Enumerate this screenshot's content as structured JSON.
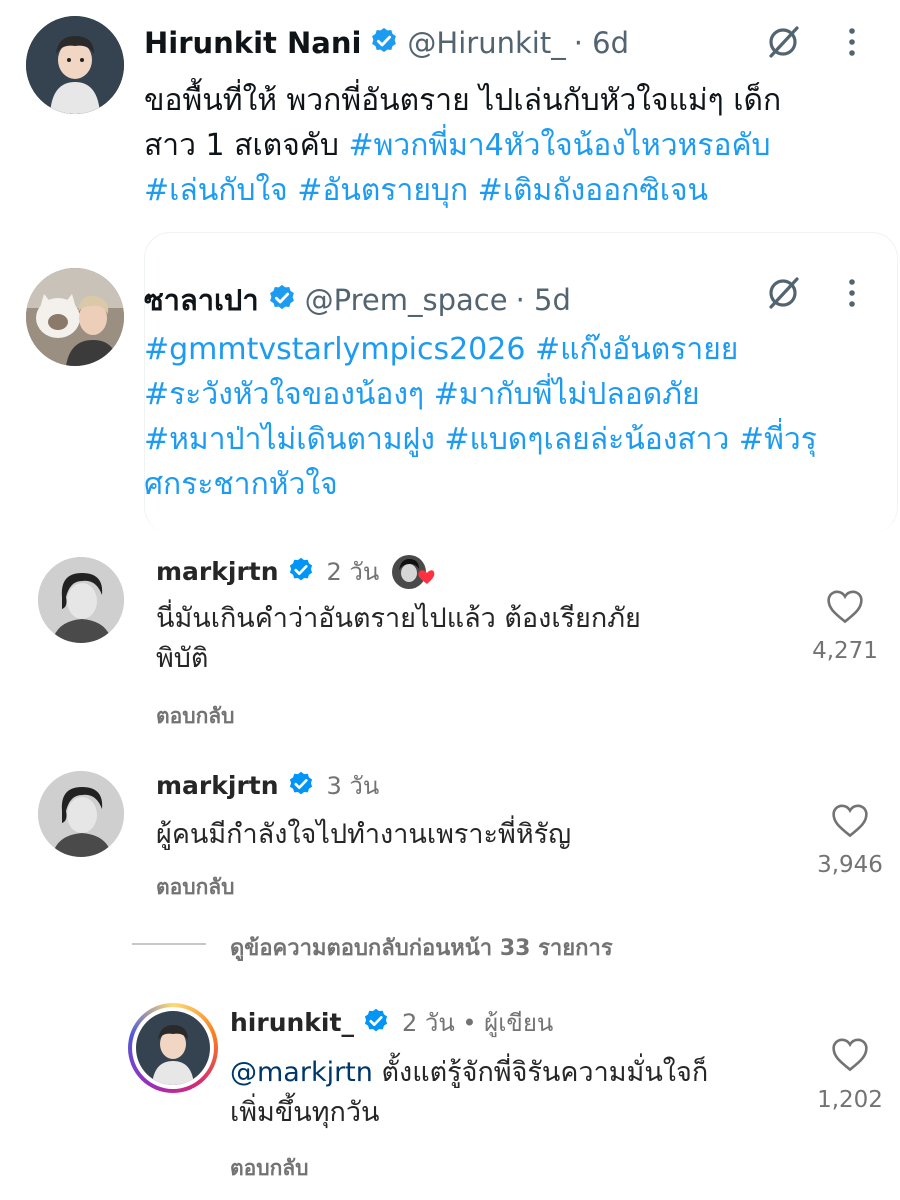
{
  "tweets": [
    {
      "name": "Hirunkit Nani",
      "handle": "@Hirunkit_",
      "time": "· 6d",
      "line1": "ขอพื้นที่ให้ พวกพี่อันตราย ไปเล่นกับหัวใจแม่ๆ เด็ก",
      "line2_text": "สาว 1 สเตจคับ ",
      "line2_tag": "#พวกพี่มา4หัวใจน้องไหวหรอคับ",
      "line3_tag": "#เล่นกับใจ #อันตรายบุก #เติมถังออกซิเจน"
    },
    {
      "name": "ซาลาเปา",
      "handle": "@Prem_space",
      "time": "· 5d",
      "line1_tag": "#gmmtvstarlympics2026 #แก๊งอันตรายย",
      "line2_tag": "#ระวังหัวใจของน้องๆ #มากับพี่ไม่ปลอดภัย",
      "line3_tag": "#หมาป่าไม่เดินตามฝูง #แบดๆเลยล่ะน้องสาว #พี่วรุ",
      "line4_tag": "ศกระชากหัวใจ"
    }
  ],
  "comments": [
    {
      "username": "markjrtn",
      "time": "2 วัน",
      "line1": "นี่มันเกินคำว่าอันตรายไปแล้ว ต้องเรียกภัย",
      "line2": "พิบัติ",
      "reply": "ตอบกลับ",
      "likes": "4,271"
    },
    {
      "username": "markjrtn",
      "time": "3 วัน",
      "line1": "ผู้คนมีกำลังใจไปทำงานเพราะพี่หิรัญ",
      "reply": "ตอบกลับ",
      "likes": "3,946"
    }
  ],
  "view_more": "ดูข้อความตอบกลับก่อนหน้า 33 รายการ",
  "reply_comment": {
    "username": "hirunkit_",
    "time": "2 วัน • ผู้เขียน",
    "mention": "@markjrtn",
    "line1": " ตั้งแต่รู้จักพี่จิรันความมั่นใจก็",
    "line2": "เพิ่มขึ้นทุกวัน",
    "reply": "ตอบกลับ",
    "likes": "1,202"
  },
  "colors": {
    "tweet_link": "#1d9bf0",
    "verified_blue": "#1d9bf0",
    "ig_verified": "#0095f6",
    "heart_like_badge": "#ff3040"
  },
  "icons": [
    "grok-icon",
    "more-icon",
    "verified-icon",
    "heart-icon"
  ]
}
